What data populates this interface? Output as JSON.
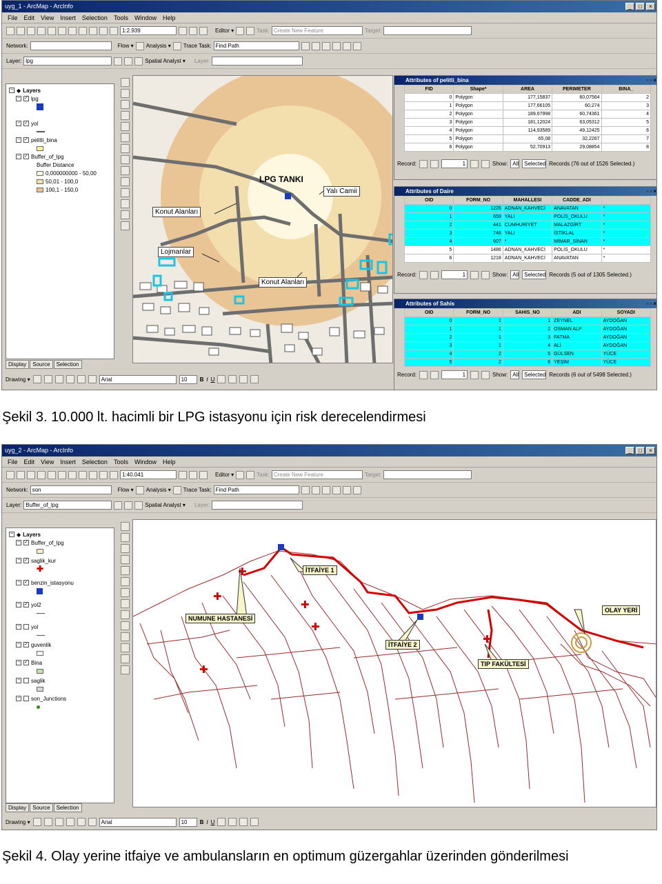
{
  "figure1": {
    "window_title": "uyg_1 - ArcMap - ArcInfo",
    "menu": [
      "File",
      "Edit",
      "View",
      "Insert",
      "Selection",
      "Tools",
      "Window",
      "Help"
    ],
    "scale": "1:2.939",
    "editor_label": "Editor ▾",
    "task_label": "Task:",
    "task_value": "Create New Feature",
    "target_label": "Target:",
    "network_label": "Network:",
    "flow_label": "Flow ▾",
    "analysis_label": "Analysis ▾",
    "trace_task_label": "Trace Task:",
    "trace_task_value": "Find Path",
    "layer_label": "Layer:",
    "layer_value": "lpg",
    "spatial_analyst_label": "Spatial Analyst ▾",
    "sa_layer_label": "Layer:",
    "toc": {
      "root": "Layers",
      "items": [
        {
          "name": "lpg",
          "level": 1,
          "checked": true
        },
        {
          "name": "yol",
          "level": 1,
          "checked": true
        },
        {
          "name": "pelitli_bina",
          "level": 1,
          "checked": true
        },
        {
          "name": "Buffer_of_lpg",
          "level": 1,
          "checked": true
        },
        {
          "name": "Buffer Distance",
          "level": 2
        },
        {
          "name": "0,000000000 - 50,00",
          "level": 3,
          "color": "#fffbe0"
        },
        {
          "name": "50,01 - 100,0",
          "level": 3,
          "color": "#f6e3a6"
        },
        {
          "name": "100,1 - 150,0",
          "level": 3,
          "color": "#eec48c"
        }
      ]
    },
    "toc_tabs": [
      "Display",
      "Source",
      "Selection"
    ],
    "map_labels": {
      "lpg": "LPG TANKI",
      "yali": "Yalı Camii",
      "konut1": "Konut Alanları",
      "lojman": "Lojmanlar",
      "konut2": "Konut Alanları"
    },
    "drawing": {
      "label": "Drawing ▾",
      "font": "Arial",
      "size": "10",
      "bold": "B",
      "italic": "I",
      "underline": "U"
    },
    "tables": [
      {
        "title": "Attributes of pelitli_bina",
        "columns": [
          "FID",
          "Shape*",
          "AREA",
          "PERIMETER",
          "BINA_"
        ],
        "rows": [
          [
            "0",
            "Polygon",
            "177,15837",
            "60,07564",
            "2"
          ],
          [
            "1",
            "Polygon",
            "177,66105",
            "60,274",
            "3"
          ],
          [
            "2",
            "Polygon",
            "189,67998",
            "60,74361",
            "4"
          ],
          [
            "3",
            "Polygon",
            "181,12024",
            "63,05312",
            "5"
          ],
          [
            "4",
            "Polygon",
            "114,93589",
            "49,12425",
            "6"
          ],
          [
            "5",
            "Polygon",
            "65,08",
            "32,2267",
            "7"
          ],
          [
            "6",
            "Polygon",
            "52,70913",
            "29,08854",
            "8"
          ]
        ],
        "record_label": "Record:",
        "record_value": "1",
        "show_label": "Show:",
        "all_label": "All",
        "selected_label": "Selected",
        "records_text": "Records (76 out of 1526 Selected.)"
      },
      {
        "title": "Attributes of Daire",
        "columns": [
          "OID",
          "FORM_NO",
          "MAHALLESI",
          "CADDE_ADI",
          ""
        ],
        "rows": [
          [
            "0",
            "1226",
            "ADNAN_KAHVECİ",
            "ANAVATAN",
            "*"
          ],
          [
            "1",
            "659",
            "YALI",
            "POLİS_OKULU",
            "*"
          ],
          [
            "2",
            "441",
            "CUMHURİYET",
            "MALAZGİRT",
            "*"
          ],
          [
            "3",
            "746",
            "YALI",
            "İSTİKLAL",
            "*"
          ],
          [
            "4",
            "607",
            "*",
            "MİMAR_SİNAN",
            "*"
          ],
          [
            "5",
            "1486",
            "ADNAN_KAHVECİ",
            "POLİS_OKULU",
            "*"
          ],
          [
            "6",
            "1218",
            "ADNAN_KAHVECİ",
            "ANAVATAN",
            "*"
          ]
        ],
        "record_label": "Record:",
        "record_value": "1",
        "show_label": "Show:",
        "all_label": "All",
        "selected_label": "Selected",
        "records_text": "Records (5 out of 1305 Selected.)"
      },
      {
        "title": "Attributes of Sahis",
        "columns": [
          "OID",
          "FORM_NO",
          "SAHIS_NO",
          "ADI",
          "SOYADI"
        ],
        "rows": [
          [
            "0",
            "1",
            "1",
            "ZEYNEL",
            "AYDOĞAN"
          ],
          [
            "1",
            "1",
            "2",
            "OSMAN ALP",
            "AYDOĞAN"
          ],
          [
            "2",
            "1",
            "3",
            "FATMA",
            "AYDOĞAN"
          ],
          [
            "3",
            "1",
            "4",
            "ALİ",
            "AYDOĞAN"
          ],
          [
            "4",
            "2",
            "5",
            "GÜLSEN",
            "YÜCE"
          ],
          [
            "5",
            "2",
            "6",
            "YEŞİM",
            "YÜCE"
          ]
        ],
        "record_label": "Record:",
        "record_value": "1",
        "show_label": "Show:",
        "all_label": "All",
        "selected_label": "Selected",
        "records_text": "Records (6 out of 5498 Selected.)"
      }
    ]
  },
  "caption1": "Şekil 3. 10.000 lt. hacimli bir LPG istasyonu için risk derecelendirmesi",
  "figure2": {
    "window_title": "uyg_2 - ArcMap - ArcInfo",
    "menu": [
      "File",
      "Edit",
      "View",
      "Insert",
      "Selection",
      "Tools",
      "Window",
      "Help"
    ],
    "scale": "1:40.041",
    "editor_label": "Editor ▾",
    "task_label": "Task:",
    "task_value": "Create New Feature",
    "target_label": "Target:",
    "network_label": "Network:",
    "network_value": "son",
    "flow_label": "Flow ▾",
    "analysis_label": "Analysis ▾",
    "trace_task_label": "Trace Task:",
    "trace_task_value": "Find Path",
    "layer_label": "Layer:",
    "layer_value": "Buffer_of_lpg",
    "spatial_analyst_label": "Spatial Analyst ▾",
    "sa_layer_label": "Layer:",
    "toc": {
      "root": "Layers",
      "items": [
        {
          "name": "Buffer_of_lpg",
          "checked": true,
          "sym": "box",
          "color": "#f7f2c8"
        },
        {
          "name": "saglik_kur",
          "checked": true,
          "sym": "cross"
        },
        {
          "name": "benzin_istasyonu",
          "checked": true,
          "sym": "blue"
        },
        {
          "name": "yol2",
          "checked": true,
          "sym": "line"
        },
        {
          "name": "yol",
          "checked": false,
          "sym": "line"
        },
        {
          "name": "guvenlik",
          "checked": true,
          "sym": "box",
          "color": "#ffffff"
        },
        {
          "name": "Bina",
          "checked": true,
          "sym": "box",
          "color": "#c6e0b4"
        },
        {
          "name": "saglik",
          "checked": false,
          "sym": "box",
          "color": "#d8d8d8"
        },
        {
          "name": "son_Junctions",
          "checked": false,
          "sym": "box",
          "color": "#7ab04a"
        }
      ]
    },
    "toc_tabs": [
      "Display",
      "Source",
      "Selection"
    ],
    "map_labels": {
      "itfaiye1": "İTFAİYE 1",
      "numune": "NUMUNE HASTANESİ",
      "itfaiye2": "İTFAİYE 2",
      "olay": "OLAY YERİ",
      "tip": "TIP FAKÜLTESİ"
    },
    "drawing": {
      "label": "Drawing ▾",
      "font": "Arial",
      "size": "10",
      "bold": "B",
      "italic": "I",
      "underline": "U"
    }
  },
  "caption2": "Şekil 4.   Olay yerine itfaiye ve ambulansların en optimum güzergahlar üzerinden gönderilmesi",
  "colors": {
    "title_bar": "#0a246a",
    "selection": "#00ffff",
    "route": "#d40000",
    "roads": "#9a2a2a"
  }
}
